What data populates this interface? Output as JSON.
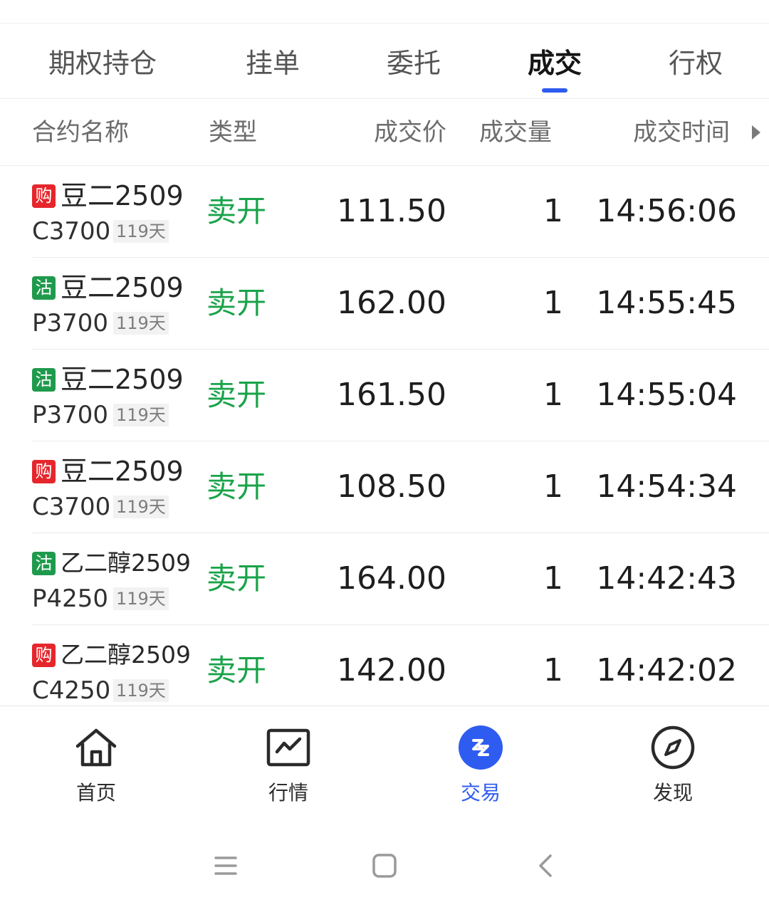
{
  "tabs": [
    {
      "label": "期权持仓"
    },
    {
      "label": "挂单"
    },
    {
      "label": "委托"
    },
    {
      "label": "成交",
      "active": true
    },
    {
      "label": "行权"
    }
  ],
  "columns": {
    "name": "合约名称",
    "type": "类型",
    "price": "成交价",
    "qty": "成交量",
    "time": "成交时间"
  },
  "rows": [
    {
      "badge": "购",
      "badge_color": "#e5262b",
      "name": "豆二2509",
      "code": "C3700",
      "days": "119天",
      "type": "卖开",
      "price": "111.50",
      "qty": "1",
      "time": "14:56:06"
    },
    {
      "badge": "沽",
      "badge_color": "#1f9a4d",
      "name": "豆二2509",
      "code": "P3700",
      "days": "119天",
      "type": "卖开",
      "price": "162.00",
      "qty": "1",
      "time": "14:55:45"
    },
    {
      "badge": "沽",
      "badge_color": "#1f9a4d",
      "name": "豆二2509",
      "code": "P3700",
      "days": "119天",
      "type": "卖开",
      "price": "161.50",
      "qty": "1",
      "time": "14:55:04"
    },
    {
      "badge": "购",
      "badge_color": "#e5262b",
      "name": "豆二2509",
      "code": "C3700",
      "days": "119天",
      "type": "卖开",
      "price": "108.50",
      "qty": "1",
      "time": "14:54:34"
    },
    {
      "badge": "沽",
      "badge_color": "#1f9a4d",
      "name": "乙二醇2509",
      "code": "P4250",
      "days": "119天",
      "type": "卖开",
      "price": "164.00",
      "qty": "1",
      "time": "14:42:43"
    },
    {
      "badge": "购",
      "badge_color": "#e5262b",
      "name": "乙二醇2509",
      "code": "C4250",
      "days": "119天",
      "type": "卖开",
      "price": "142.00",
      "qty": "1",
      "time": "14:42:02"
    }
  ],
  "bottom_nav": [
    {
      "label": "首页",
      "icon": "home-icon"
    },
    {
      "label": "行情",
      "icon": "chart-icon"
    },
    {
      "label": "交易",
      "icon": "trade-icon",
      "active": true
    },
    {
      "label": "发现",
      "icon": "compass-icon"
    }
  ],
  "colors": {
    "accent": "#2f5cf0",
    "sell_open": "#1aa34a",
    "call_badge": "#e5262b",
    "put_badge": "#1f9a4d"
  }
}
